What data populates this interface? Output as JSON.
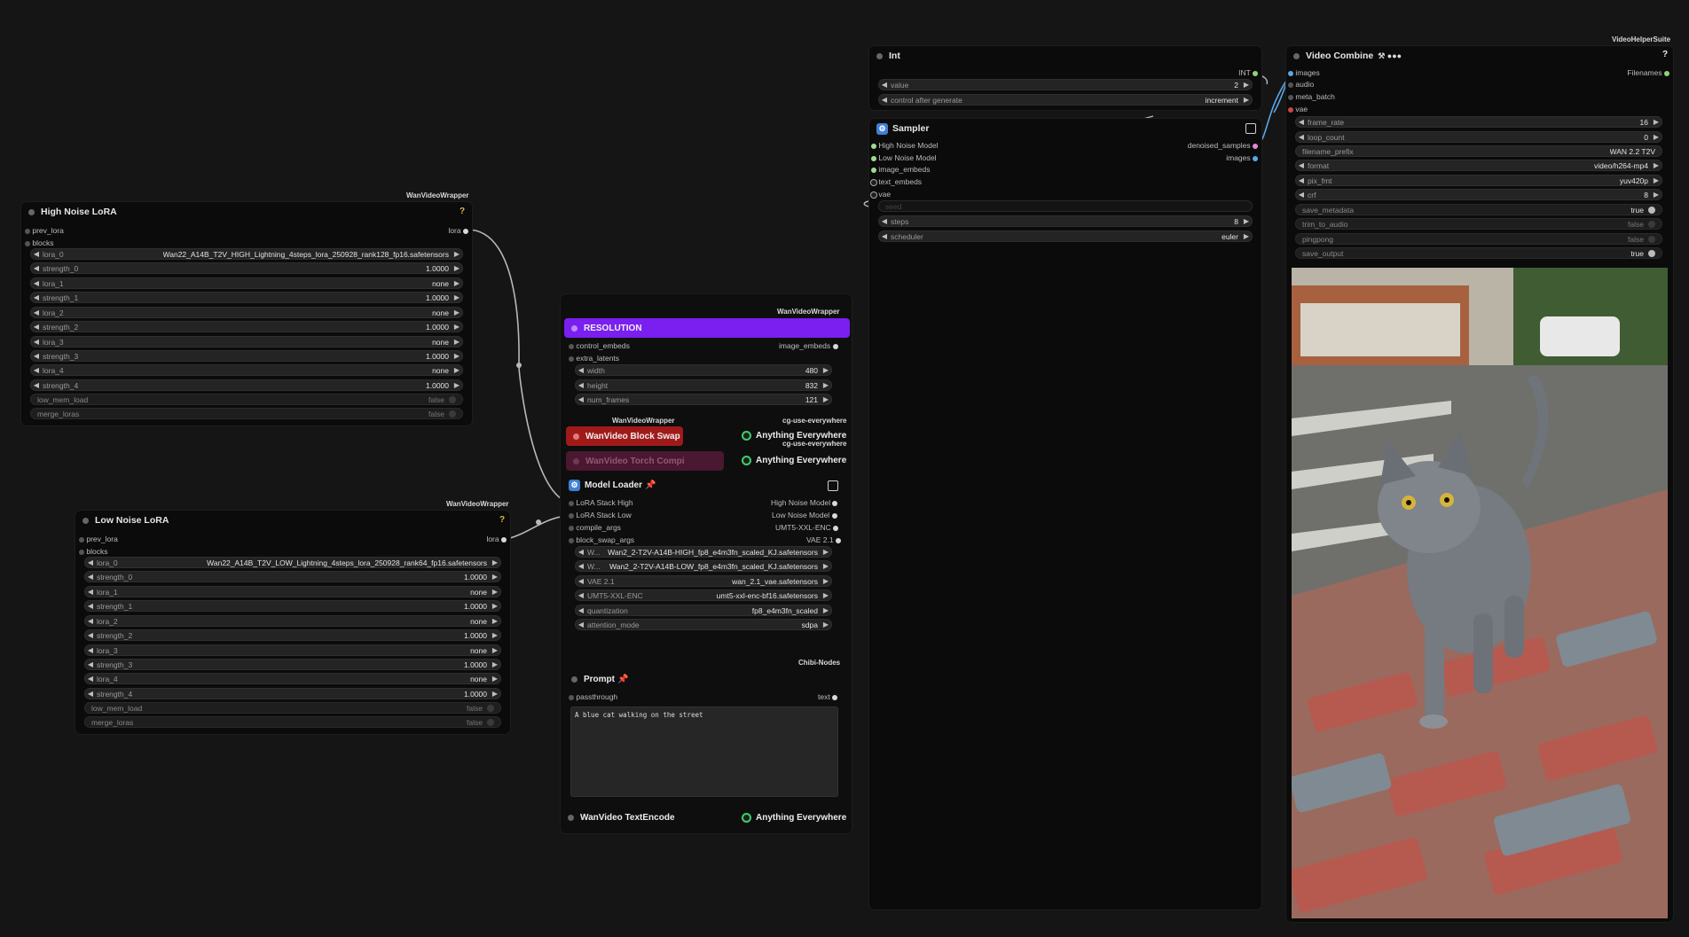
{
  "high_lora": {
    "provider": "WanVideoWrapper",
    "title": "High Noise LoRA",
    "help": "?",
    "inputs": [
      "prev_lora",
      "blocks"
    ],
    "output": "lora",
    "widgets": [
      {
        "label": "lora_0",
        "value": "Wan22_A14B_T2V_HIGH_Lightning_4steps_lora_250928_rank128_fp16.safetensors"
      },
      {
        "label": "strength_0",
        "value": "1.0000"
      },
      {
        "label": "lora_1",
        "value": "none"
      },
      {
        "label": "strength_1",
        "value": "1.0000"
      },
      {
        "label": "lora_2",
        "value": "none"
      },
      {
        "label": "strength_2",
        "value": "1.0000"
      },
      {
        "label": "lora_3",
        "value": "none"
      },
      {
        "label": "strength_3",
        "value": "1.0000"
      },
      {
        "label": "lora_4",
        "value": "none"
      },
      {
        "label": "strength_4",
        "value": "1.0000"
      }
    ],
    "toggles": [
      {
        "label": "low_mem_load",
        "value": "false"
      },
      {
        "label": "merge_loras",
        "value": "false"
      }
    ]
  },
  "low_lora": {
    "provider": "WanVideoWrapper",
    "title": "Low Noise LoRA",
    "help": "?",
    "inputs": [
      "prev_lora",
      "blocks"
    ],
    "output": "lora",
    "widgets": [
      {
        "label": "lora_0",
        "value": "Wan22_A14B_T2V_LOW_Lightning_4steps_lora_250928_rank64_fp16.safetensors"
      },
      {
        "label": "strength_0",
        "value": "1.0000"
      },
      {
        "label": "lora_1",
        "value": "none"
      },
      {
        "label": "strength_1",
        "value": "1.0000"
      },
      {
        "label": "lora_2",
        "value": "none"
      },
      {
        "label": "strength_2",
        "value": "1.0000"
      },
      {
        "label": "lora_3",
        "value": "none"
      },
      {
        "label": "strength_3",
        "value": "1.0000"
      },
      {
        "label": "lora_4",
        "value": "none"
      },
      {
        "label": "strength_4",
        "value": "1.0000"
      }
    ],
    "toggles": [
      {
        "label": "low_mem_load",
        "value": "false"
      },
      {
        "label": "merge_loras",
        "value": "false"
      }
    ]
  },
  "resolution": {
    "provider": "WanVideoWrapper",
    "title": "RESOLUTION",
    "inputs": [
      "control_embeds",
      "extra_latents"
    ],
    "output": "image_embeds",
    "widgets": [
      {
        "label": "width",
        "value": "480"
      },
      {
        "label": "height",
        "value": "832"
      },
      {
        "label": "num_frames",
        "value": "121"
      }
    ]
  },
  "block_swap": {
    "provider": "WanVideoWrapper",
    "title": "WanVideo Block Swap",
    "everywhere_provider": "cg-use-everywhere",
    "everywhere": "Anything Everywhere"
  },
  "torch_compile": {
    "title": "WanVideo Torch Compi",
    "everywhere_provider": "cg-use-everywhere",
    "everywhere": "Anything Everywhere"
  },
  "model_loader": {
    "title": "Model Loader",
    "inputs": [
      "LoRA Stack High",
      "LoRA Stack Low",
      "compile_args",
      "block_swap_args"
    ],
    "outputs": [
      "High Noise Model",
      "Low Noise Model",
      "UMT5-XXL-ENC",
      "VAE 2.1"
    ],
    "widgets": [
      {
        "label": "W...",
        "value": "Wan2_2-T2V-A14B-HIGH_fp8_e4m3fn_scaled_KJ.safetensors"
      },
      {
        "label": "W...",
        "value": "Wan2_2-T2V-A14B-LOW_fp8_e4m3fn_scaled_KJ.safetensors"
      },
      {
        "label": "VAE 2.1",
        "value": "wan_2.1_vae.safetensors"
      },
      {
        "label": "UMT5-XXL-ENC",
        "value": "umt5-xxl-enc-bf16.safetensors"
      },
      {
        "label": "quantization",
        "value": "fp8_e4m3fn_scaled"
      },
      {
        "label": "attention_mode",
        "value": "sdpa"
      }
    ]
  },
  "prompt": {
    "provider": "Chibi-Nodes",
    "title": "Prompt",
    "input": "passthrough",
    "output": "text",
    "text": "A blue cat walking on the street"
  },
  "text_encode": {
    "title": "WanVideo TextEncode",
    "everywhere": "Anything Everywhere"
  },
  "int_node": {
    "title": "Int",
    "output": "INT",
    "widgets": [
      {
        "label": "value",
        "value": "2"
      },
      {
        "label": "control after generate",
        "value": "increment"
      }
    ]
  },
  "sampler": {
    "title": "Sampler",
    "inputs": [
      "High Noise Model",
      "Low Noise Model",
      "image_embeds",
      "text_embeds",
      "vae"
    ],
    "outputs": [
      "denoised_samples",
      "images"
    ],
    "seed_label": "seed",
    "widgets": [
      {
        "label": "steps",
        "value": "8"
      },
      {
        "label": "scheduler",
        "value": "euler"
      }
    ]
  },
  "video_combine": {
    "provider": "VideoHelperSuite",
    "title": "Video Combine",
    "title_icons": "⚒ ●●●",
    "help": "?",
    "inputs": [
      "images",
      "audio",
      "meta_batch",
      "vae"
    ],
    "output": "Filenames",
    "widgets": [
      {
        "label": "frame_rate",
        "value": "16"
      },
      {
        "label": "loop_count",
        "value": "0"
      },
      {
        "label": "filename_prefix",
        "value": "WAN 2.2 T2V"
      },
      {
        "label": "format",
        "value": "video/h264-mp4"
      },
      {
        "label": "pix_fmt",
        "value": "yuv420p"
      },
      {
        "label": "crf",
        "value": "8"
      }
    ],
    "toggles": [
      {
        "label": "save_metadata",
        "value": "true"
      },
      {
        "label": "trim_to_audio",
        "value": "false"
      },
      {
        "label": "pingpong",
        "value": "false"
      },
      {
        "label": "save_output",
        "value": "true"
      }
    ]
  },
  "colors": {
    "resolution_bar": "#7a1ff0",
    "block_swap_bar": "#a11a1a",
    "torch_bar": "#4a1830",
    "wire": "#b8b8b8",
    "image_wire": "#5aa7e6"
  }
}
